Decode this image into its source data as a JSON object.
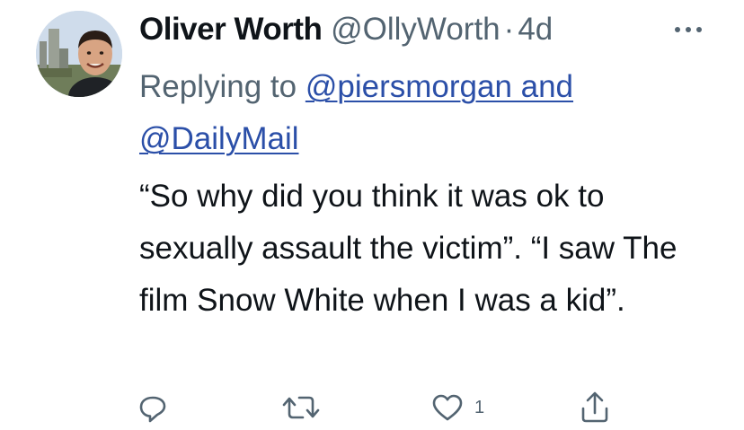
{
  "tweet": {
    "author_name": "Oliver Worth",
    "author_handle": "@OllyWorth",
    "separator": "·",
    "timestamp": "4d",
    "replying_prefix": "Replying to",
    "replying_to_link_1": "@piersmorgan and",
    "replying_to_link_2": "@DailyMail",
    "text": "“So why did you think it was ok to sexually assault the victim”. “I saw The film Snow White when I was a kid”."
  },
  "actions": {
    "reply_count": "",
    "retweet_count": "",
    "like_count": "1",
    "share_count": ""
  },
  "icons": {
    "more": "more-horizontal-icon",
    "reply": "reply-icon",
    "retweet": "retweet-icon",
    "like": "heart-icon",
    "share": "share-icon"
  },
  "colors": {
    "text_primary": "#0f1419",
    "text_secondary": "#536471",
    "link": "#2b4fa8"
  }
}
